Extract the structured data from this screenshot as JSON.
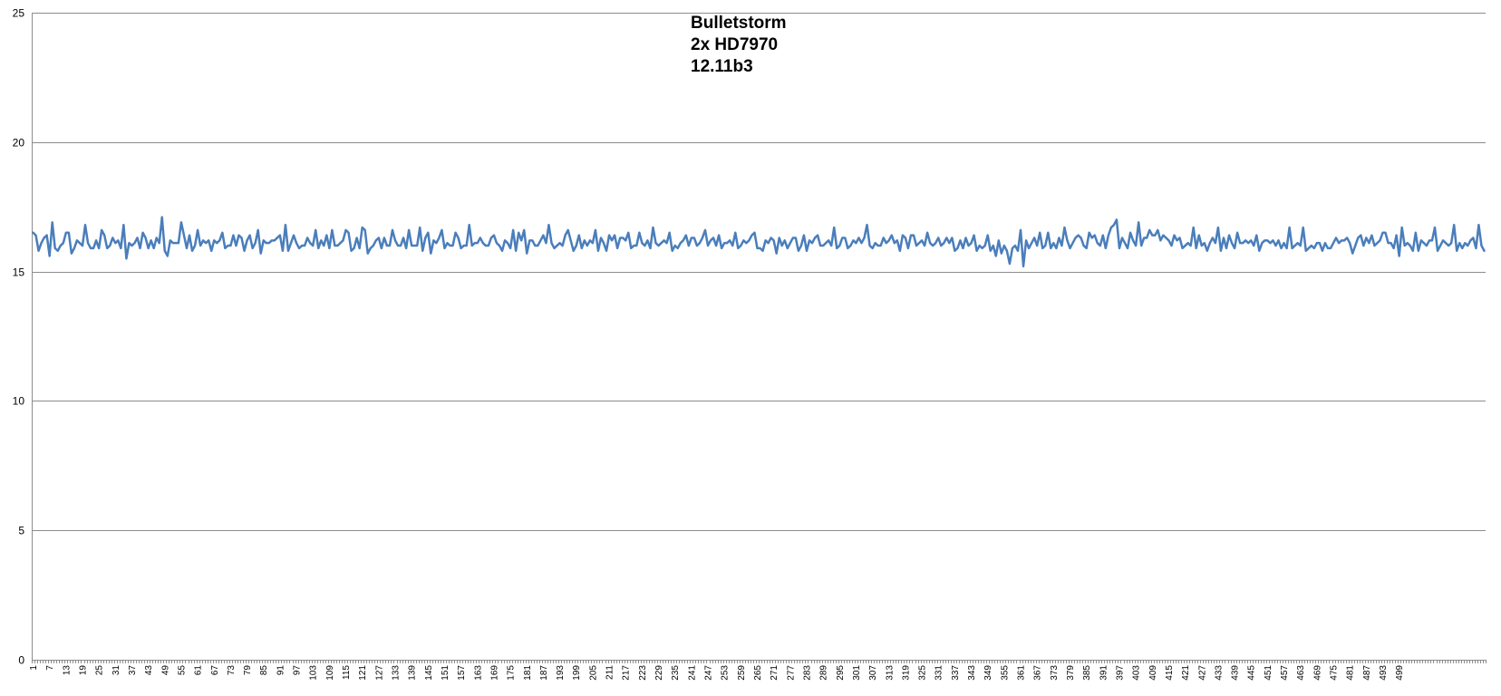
{
  "chart_data": {
    "type": "line",
    "title_lines": [
      "Bulletstorm",
      "2x HD7970",
      "12.11b3"
    ],
    "xlabel": "",
    "ylabel": "",
    "ylim": [
      0,
      25
    ],
    "yticks": [
      0,
      5,
      10,
      15,
      20,
      25
    ],
    "x_start": 1,
    "x_end": 500,
    "x_tick_labels_every": 6,
    "grid": "horizontal",
    "legend": "none",
    "line_color": "#4a7ebb",
    "series": [
      {
        "values": [
          16.5,
          16.4,
          15.8,
          16.1,
          16.3,
          16.4,
          15.6,
          16.9,
          15.9,
          15.8,
          16.0,
          16.1,
          16.5,
          16.5,
          15.7,
          15.9,
          16.2,
          16.1,
          16.0,
          16.8,
          16.1,
          15.9,
          15.9,
          16.2,
          15.9,
          16.6,
          16.4,
          15.9,
          16.0,
          16.3,
          16.1,
          16.2,
          15.9,
          16.8,
          15.5,
          16.1,
          16.0,
          16.1,
          16.3,
          15.9,
          16.5,
          16.3,
          15.9,
          16.2,
          15.9,
          16.3,
          16.1,
          17.1,
          15.8,
          15.6,
          16.2,
          16.1,
          16.1,
          16.1,
          16.9,
          16.4,
          15.9,
          16.4,
          15.8,
          16.0,
          16.6,
          16.0,
          16.2,
          16.1,
          16.2,
          15.8,
          16.2,
          16.1,
          16.2,
          16.5,
          15.9,
          16.0,
          16.0,
          16.4,
          16.0,
          16.4,
          16.3,
          15.8,
          16.2,
          16.4,
          15.9,
          16.1,
          16.6,
          15.7,
          16.2,
          16.1,
          16.1,
          16.2,
          16.2,
          16.3,
          16.4,
          15.8,
          16.8,
          15.8,
          16.1,
          16.4,
          16.1,
          15.9,
          16.0,
          16.0,
          16.3,
          16.1,
          16.0,
          16.6,
          15.9,
          16.2,
          16.0,
          16.4,
          15.9,
          16.6,
          16.0,
          16.0,
          16.1,
          16.2,
          16.6,
          16.5,
          15.8,
          15.9,
          16.3,
          15.9,
          16.7,
          16.6,
          15.7,
          15.9,
          16.0,
          16.2,
          16.3,
          15.9,
          16.3,
          16.0,
          16.0,
          16.6,
          16.2,
          16.0,
          16.0,
          16.3,
          15.9,
          16.6,
          16.0,
          16.0,
          16.0,
          16.7,
          15.8,
          16.3,
          16.5,
          15.7,
          16.2,
          16.1,
          16.3,
          16.6,
          15.9,
          16.1,
          16.0,
          16.0,
          16.5,
          16.3,
          15.9,
          16.0,
          16.0,
          16.8,
          16.0,
          16.1,
          16.1,
          16.3,
          16.1,
          16.0,
          16.0,
          16.3,
          16.4,
          16.1,
          16.0,
          15.8,
          16.2,
          16.1,
          15.9,
          16.6,
          15.8,
          16.5,
          16.2,
          16.6,
          15.7,
          16.2,
          16.2,
          16.0,
          16.0,
          16.2,
          16.4,
          16.1,
          16.8,
          16.1,
          15.9,
          16.0,
          16.1,
          16.0,
          16.4,
          16.6,
          16.2,
          15.8,
          16.0,
          16.4,
          15.9,
          16.2,
          16.0,
          16.2,
          16.1,
          16.6,
          15.8,
          16.3,
          16.1,
          15.8,
          16.4,
          16.2,
          16.4,
          15.9,
          16.3,
          16.3,
          16.2,
          16.5,
          15.9,
          16.0,
          16.0,
          16.5,
          16.1,
          16.0,
          16.2,
          15.9,
          16.7,
          16.1,
          16.0,
          16.1,
          16.2,
          16.1,
          16.5,
          15.8,
          16.0,
          15.9,
          16.1,
          16.2,
          16.4,
          16.0,
          16.3,
          16.3,
          16.0,
          16.1,
          16.3,
          16.6,
          16.0,
          16.2,
          16.3,
          16.0,
          16.4,
          15.9,
          16.1,
          16.1,
          16.2,
          16.0,
          16.5,
          15.9,
          16.0,
          16.2,
          16.1,
          16.2,
          16.4,
          16.5,
          15.9,
          15.9,
          15.8,
          16.2,
          16.1,
          16.3,
          16.2,
          15.7,
          16.3,
          16.0,
          16.2,
          15.9,
          16.1,
          16.3,
          16.3,
          15.8,
          16.0,
          16.4,
          15.8,
          16.2,
          16.1,
          16.3,
          16.4,
          16.0,
          16.0,
          16.1,
          16.2,
          16.0,
          16.7,
          15.9,
          16.0,
          16.3,
          16.3,
          15.9,
          16.0,
          16.2,
          16.1,
          16.3,
          16.1,
          16.3,
          16.8,
          16.0,
          15.9,
          16.1,
          16.0,
          16.0,
          16.3,
          16.1,
          16.2,
          16.4,
          16.1,
          16.2,
          15.8,
          16.4,
          16.3,
          15.9,
          16.4,
          16.4,
          16.0,
          16.1,
          16.2,
          16.0,
          16.5,
          16.1,
          16.0,
          16.1,
          16.3,
          16.0,
          16.1,
          16.3,
          16.1,
          16.3,
          15.8,
          15.9,
          16.2,
          15.9,
          16.3,
          16.0,
          16.1,
          16.4,
          15.8,
          16.0,
          15.9,
          16.0,
          16.4,
          15.8,
          16.0,
          15.6,
          16.2,
          15.7,
          16.0,
          15.8,
          15.3,
          15.9,
          16.0,
          15.8,
          16.6,
          15.2,
          16.2,
          15.9,
          16.1,
          16.3,
          16.0,
          16.5,
          15.9,
          16.0,
          16.5,
          15.9,
          16.1,
          15.9,
          16.3,
          16.0,
          16.7,
          16.2,
          15.9,
          16.1,
          16.3,
          16.4,
          16.3,
          16.0,
          15.9,
          16.5,
          16.3,
          16.4,
          16.1,
          16.0,
          16.4,
          15.9,
          16.4,
          16.7,
          16.8,
          17.0,
          15.9,
          16.3,
          16.1,
          15.9,
          16.5,
          16.2,
          16.0,
          16.9,
          16.0,
          16.3,
          16.3,
          16.6,
          16.4,
          16.4,
          16.6,
          16.2,
          16.4,
          16.3,
          16.2,
          16.0,
          16.4,
          16.2,
          16.3,
          15.9,
          16.0,
          16.1,
          16.0,
          16.7,
          15.9,
          16.4,
          16.0,
          16.1,
          15.8,
          16.1,
          16.3,
          16.1,
          16.7,
          15.8,
          16.3,
          15.9,
          16.4,
          16.1,
          15.9,
          16.5,
          16.1,
          16.1,
          16.2,
          16.1,
          16.2,
          16.0,
          16.4,
          15.8,
          16.1,
          16.2,
          16.2,
          16.1,
          16.2,
          16.0,
          16.2,
          15.9,
          16.1,
          15.9,
          16.7,
          15.9,
          16.0,
          16.1,
          16.0,
          16.7,
          15.8,
          15.9,
          16.0,
          15.9,
          16.1,
          16.1,
          15.8,
          16.1,
          15.9,
          15.9,
          16.1,
          16.3,
          16.1,
          16.2,
          16.2,
          16.3,
          16.1,
          15.7,
          16.0,
          16.3,
          16.4,
          16.0,
          16.3,
          16.1,
          16.4,
          16.0,
          16.1,
          16.2,
          16.5,
          16.5,
          16.1,
          16.1,
          15.9,
          16.4,
          15.6,
          16.7,
          16.0,
          16.1,
          16.0,
          15.8,
          16.5,
          15.8,
          16.2,
          16.1,
          16.0,
          16.2,
          16.2,
          16.7,
          15.8,
          16.0,
          16.2,
          16.1,
          16.0,
          16.1,
          16.8,
          15.8,
          16.1,
          15.9,
          16.1,
          16.0,
          16.2,
          16.3,
          15.9,
          16.8,
          16.0,
          15.8
        ]
      }
    ]
  }
}
